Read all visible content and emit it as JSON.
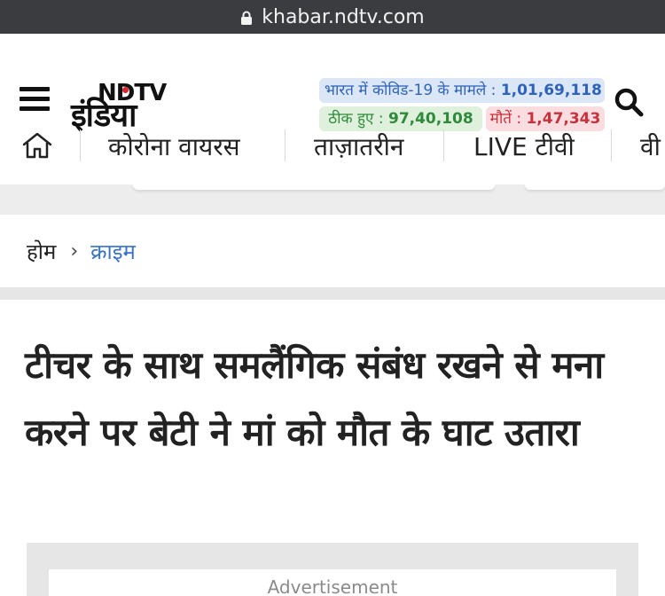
{
  "browser": {
    "url": "khabar.ndtv.com",
    "lock_icon": "lock-icon"
  },
  "header": {
    "menu_icon": "hamburger-menu-icon",
    "logo": {
      "top": "NDTV",
      "bottom": "इंडिया",
      "accent": "#d8282f"
    },
    "covid": {
      "cases_label": "भारत में कोविड-19 के मामले : ",
      "cases_value": "1,01,69,118",
      "recovered_label": "ठीक हुए : ",
      "recovered_value": "97,40,108",
      "deaths_label": "मौतें : ",
      "deaths_value": "1,47,343",
      "colors": {
        "cases": "#2f63b8",
        "recovered": "#2f8a3a",
        "deaths": "#c8323c"
      }
    },
    "search_icon": "search-icon"
  },
  "nav": {
    "home_icon": "home-icon",
    "items": [
      "कोरोना वायरस",
      "ताज़ातरीन",
      "LIVE टीवी",
      "वी"
    ]
  },
  "breadcrumb": {
    "home": "होम",
    "separator": "›",
    "category": "क्राइम",
    "link_color": "#3b73c4"
  },
  "article": {
    "headline": "टीचर के साथ समलैंगिक संबंध रखने से मना करने पर बेटी ने मां को मौत के घाट उतारा"
  },
  "ad": {
    "label": "Advertisement"
  }
}
